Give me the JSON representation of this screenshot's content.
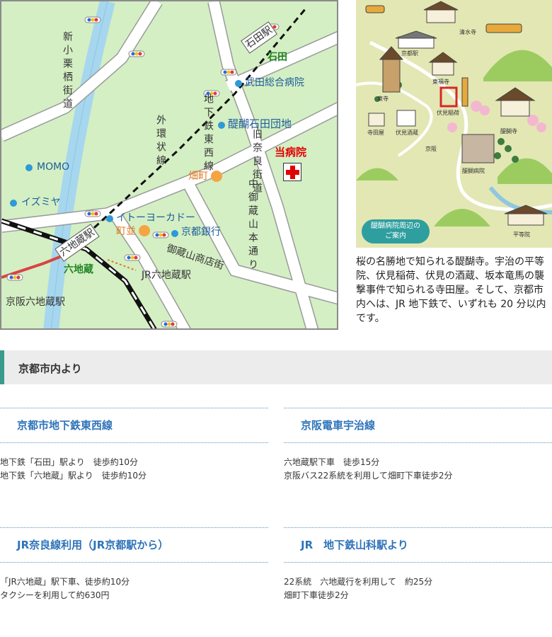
{
  "map": {
    "stations": {
      "ishida": "石田駅",
      "rokujizo_subway": "六地蔵駅",
      "rokujizo_area": "六地蔵",
      "jr_rokujizo": "JR六地蔵駅",
      "keihan_rokujizo": "京阪六地蔵駅",
      "ishida_area": "石田"
    },
    "roads": {
      "shinkurisu": "新小栗栖街道",
      "gaikan": "外環状線",
      "subway_tozai": "地下鉄東西線",
      "nara_kaido": "旧奈良街道",
      "nakagokuraya": "中御蔵山本通り",
      "gokurayama_shotengai": "御蔵山商店街"
    },
    "places": {
      "takeda": "武田総合病院",
      "daigo_ishidadanchi": "醍醐石田団地",
      "momo": "MOMO",
      "izumiya": "イズミヤ",
      "itoyokado": "イトーヨーカドー",
      "kyoto_bank": "京都銀行",
      "hospital": "当病院"
    },
    "bus_stops": {
      "hatacho": "畑町",
      "machinami": "町並"
    }
  },
  "illustration": {
    "labels": {
      "kiyomizu": "清水寺",
      "kyoto_station": "京都駅",
      "toji": "東寺",
      "tofukuji": "東福寺",
      "fushimi_inari": "伏見稲荷",
      "teradaya": "寺田屋",
      "fushimi_sake": "伏見酒蔵",
      "daigoji": "醍醐寺",
      "daigo_hospital": "醍醐病院",
      "byodoin": "平等院",
      "keihan": "京阪"
    },
    "badge_line1": "醍醐病院周辺の",
    "badge_line2": "ご案内"
  },
  "description": "桜の名勝地で知られる醍醐寺。宇治の平等院、伏見稲荷、伏見の酒蔵、坂本竜馬の襲撃事件で知られる寺田屋。そして、京都市内へは、JR 地下鉄で、いずれも 20 分以内です。",
  "access": {
    "header": "京都市内より",
    "routes": [
      {
        "title": "京都市地下鉄東西線",
        "lines": [
          "地下鉄「石田」駅より　徒歩約10分",
          "地下鉄「六地蔵」駅より　徒歩約10分"
        ]
      },
      {
        "title": "京阪電車宇治線",
        "lines": [
          "六地蔵駅下車　徒歩15分",
          "京阪バス22系統を利用して畑町下車徒歩2分"
        ]
      },
      {
        "title": "JR奈良線利用（JR京都駅から）",
        "lines": [
          "「JR六地蔵」駅下車、徒歩約10分",
          "タクシーを利用して約630円"
        ]
      },
      {
        "title": "JR　地下鉄山科駅より",
        "lines": [
          "22系統　六地蔵行を利用して　約25分",
          "畑町下車徒歩2分"
        ]
      }
    ]
  },
  "colors": {
    "map_bg": "#d4efc4",
    "river": "#a7d7ee",
    "road": "#ffffff",
    "accent": "#3a9a8c",
    "route_title": "#2f74ba",
    "hospital": "#e00000"
  }
}
